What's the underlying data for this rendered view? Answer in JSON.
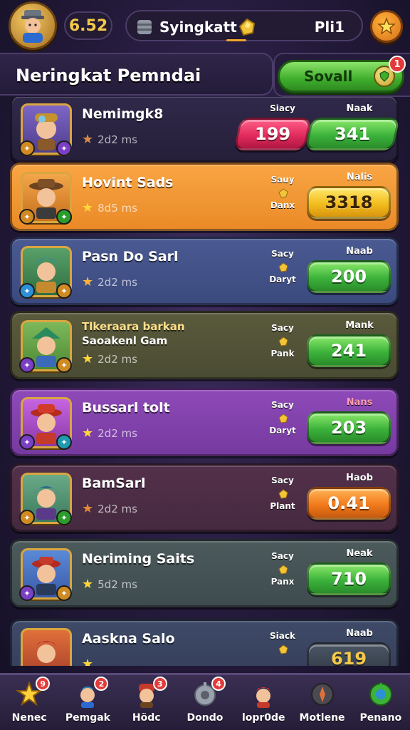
{
  "top_bar": {
    "level": "6.52",
    "resource_label": "Syingkatt",
    "resource_value": "Pli1",
    "icons": {
      "avatar": "player-avatar",
      "resource": "barrel-icon",
      "gem": "gold-nugget-icon",
      "close": "star-close-icon"
    }
  },
  "header": {
    "title": "Neringkat Pemndai",
    "sort_button_label": "Sovall",
    "notification_count": "1"
  },
  "players": [
    {
      "name": "Nemimgk8",
      "name2": "",
      "sub": "2d2 ms",
      "stat_label_top": "Siacy",
      "stat_label_bottom": "",
      "score_head": "Naak",
      "score_left": "199",
      "score": "341",
      "theme": "dark"
    },
    {
      "name": "Hovint Sads",
      "name2": "",
      "sub": "8d5 ms",
      "stat_label_top": "Sauy",
      "stat_label_bottom": "Danx",
      "score_head": "Nalis",
      "score": "3318",
      "theme": "orange"
    },
    {
      "name": "Pasn Do Sarl",
      "name2": "",
      "sub": "2d2 ms",
      "stat_label_top": "Sacy",
      "stat_label_bottom": "Daryt",
      "score_head": "Naab",
      "score": "200",
      "theme": "blue"
    },
    {
      "name": "Tlkeraara barkan",
      "name2": "Saoakenl Gam",
      "sub": "2d2 ms",
      "stat_label_top": "Sacy",
      "stat_label_bottom": "Pank",
      "score_head": "Mank",
      "score": "241",
      "theme": "olive"
    },
    {
      "name": "Bussarl tolt",
      "name2": "",
      "sub": "2d2 ms",
      "stat_label_top": "Sacy",
      "stat_label_bottom": "Daryt",
      "score_head": "Nans",
      "score": "203",
      "theme": "purple"
    },
    {
      "name": "BamSarl",
      "name2": "",
      "sub": "2d2 ms",
      "stat_label_top": "Sacy",
      "stat_label_bottom": "Plant",
      "score_head": "Haob",
      "score": "0.41",
      "theme": "plum"
    },
    {
      "name": "Neriming Saits",
      "name2": "",
      "sub": "5d2 ms",
      "stat_label_top": "Sacy",
      "stat_label_bottom": "Panx",
      "score_head": "Neak",
      "score": "710",
      "theme": "teal"
    },
    {
      "name": "Aasknа Salo",
      "name2": "",
      "sub": "",
      "stat_label_top": "Siack",
      "stat_label_bottom": "",
      "score_head": "Naab",
      "score": "619",
      "theme": "slate"
    }
  ],
  "bottom_nav": [
    {
      "label": "Nenec",
      "badge": "9",
      "icon": "star-icon"
    },
    {
      "label": "Pemgak",
      "badge": "2",
      "icon": "hero-icon"
    },
    {
      "label": "Hödc",
      "badge": "3",
      "icon": "helmet-hero-icon"
    },
    {
      "label": "Dondo",
      "badge": "4",
      "icon": "gear-knight-icon"
    },
    {
      "label": "lopr0de",
      "badge": "",
      "icon": "red-hair-hero-icon"
    },
    {
      "label": "Motlene",
      "badge": "",
      "icon": "compass-icon"
    },
    {
      "label": "Penano",
      "badge": "",
      "icon": "globe-icon"
    }
  ],
  "colors": {
    "accent_gold": "#f4c84a",
    "green_button": "#3fae2c",
    "badge_red": "#e23a3a",
    "background": "#231a3a"
  }
}
